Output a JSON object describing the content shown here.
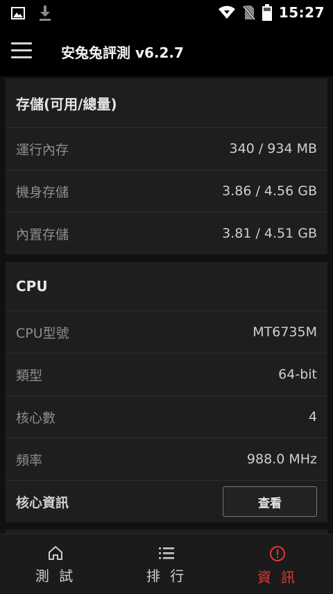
{
  "status_bar": {
    "time": "15:27",
    "icons": [
      "image-icon",
      "download-icon",
      "wifi-icon",
      "no-sim-icon",
      "battery-icon"
    ]
  },
  "app_bar": {
    "title": "安兔兔評測 v6.2.7",
    "menu_icon": "hamburger-menu-icon"
  },
  "storage": {
    "header": "存儲(可用/總量)",
    "rows": [
      {
        "label": "運行內存",
        "value": "340 / 934 MB"
      },
      {
        "label": "機身存儲",
        "value": "3.86 / 4.56 GB"
      },
      {
        "label": "內置存儲",
        "value": "3.81 / 4.51 GB"
      }
    ]
  },
  "cpu": {
    "header": "CPU",
    "rows": [
      {
        "label": "CPU型號",
        "value": "MT6735M"
      },
      {
        "label": "類型",
        "value": "64-bit"
      },
      {
        "label": "核心數",
        "value": "4"
      },
      {
        "label": "頻率",
        "value": "988.0 MHz"
      }
    ],
    "core_info_label": "核心資訊",
    "view_button": "查看"
  },
  "bottom_nav": {
    "items": [
      {
        "label": "測 試",
        "icon": "home-icon"
      },
      {
        "label": "排 行",
        "icon": "list-icon"
      },
      {
        "label": "資 訊",
        "icon": "info-icon"
      }
    ],
    "active_index": 2,
    "active_color": "#e53935"
  }
}
